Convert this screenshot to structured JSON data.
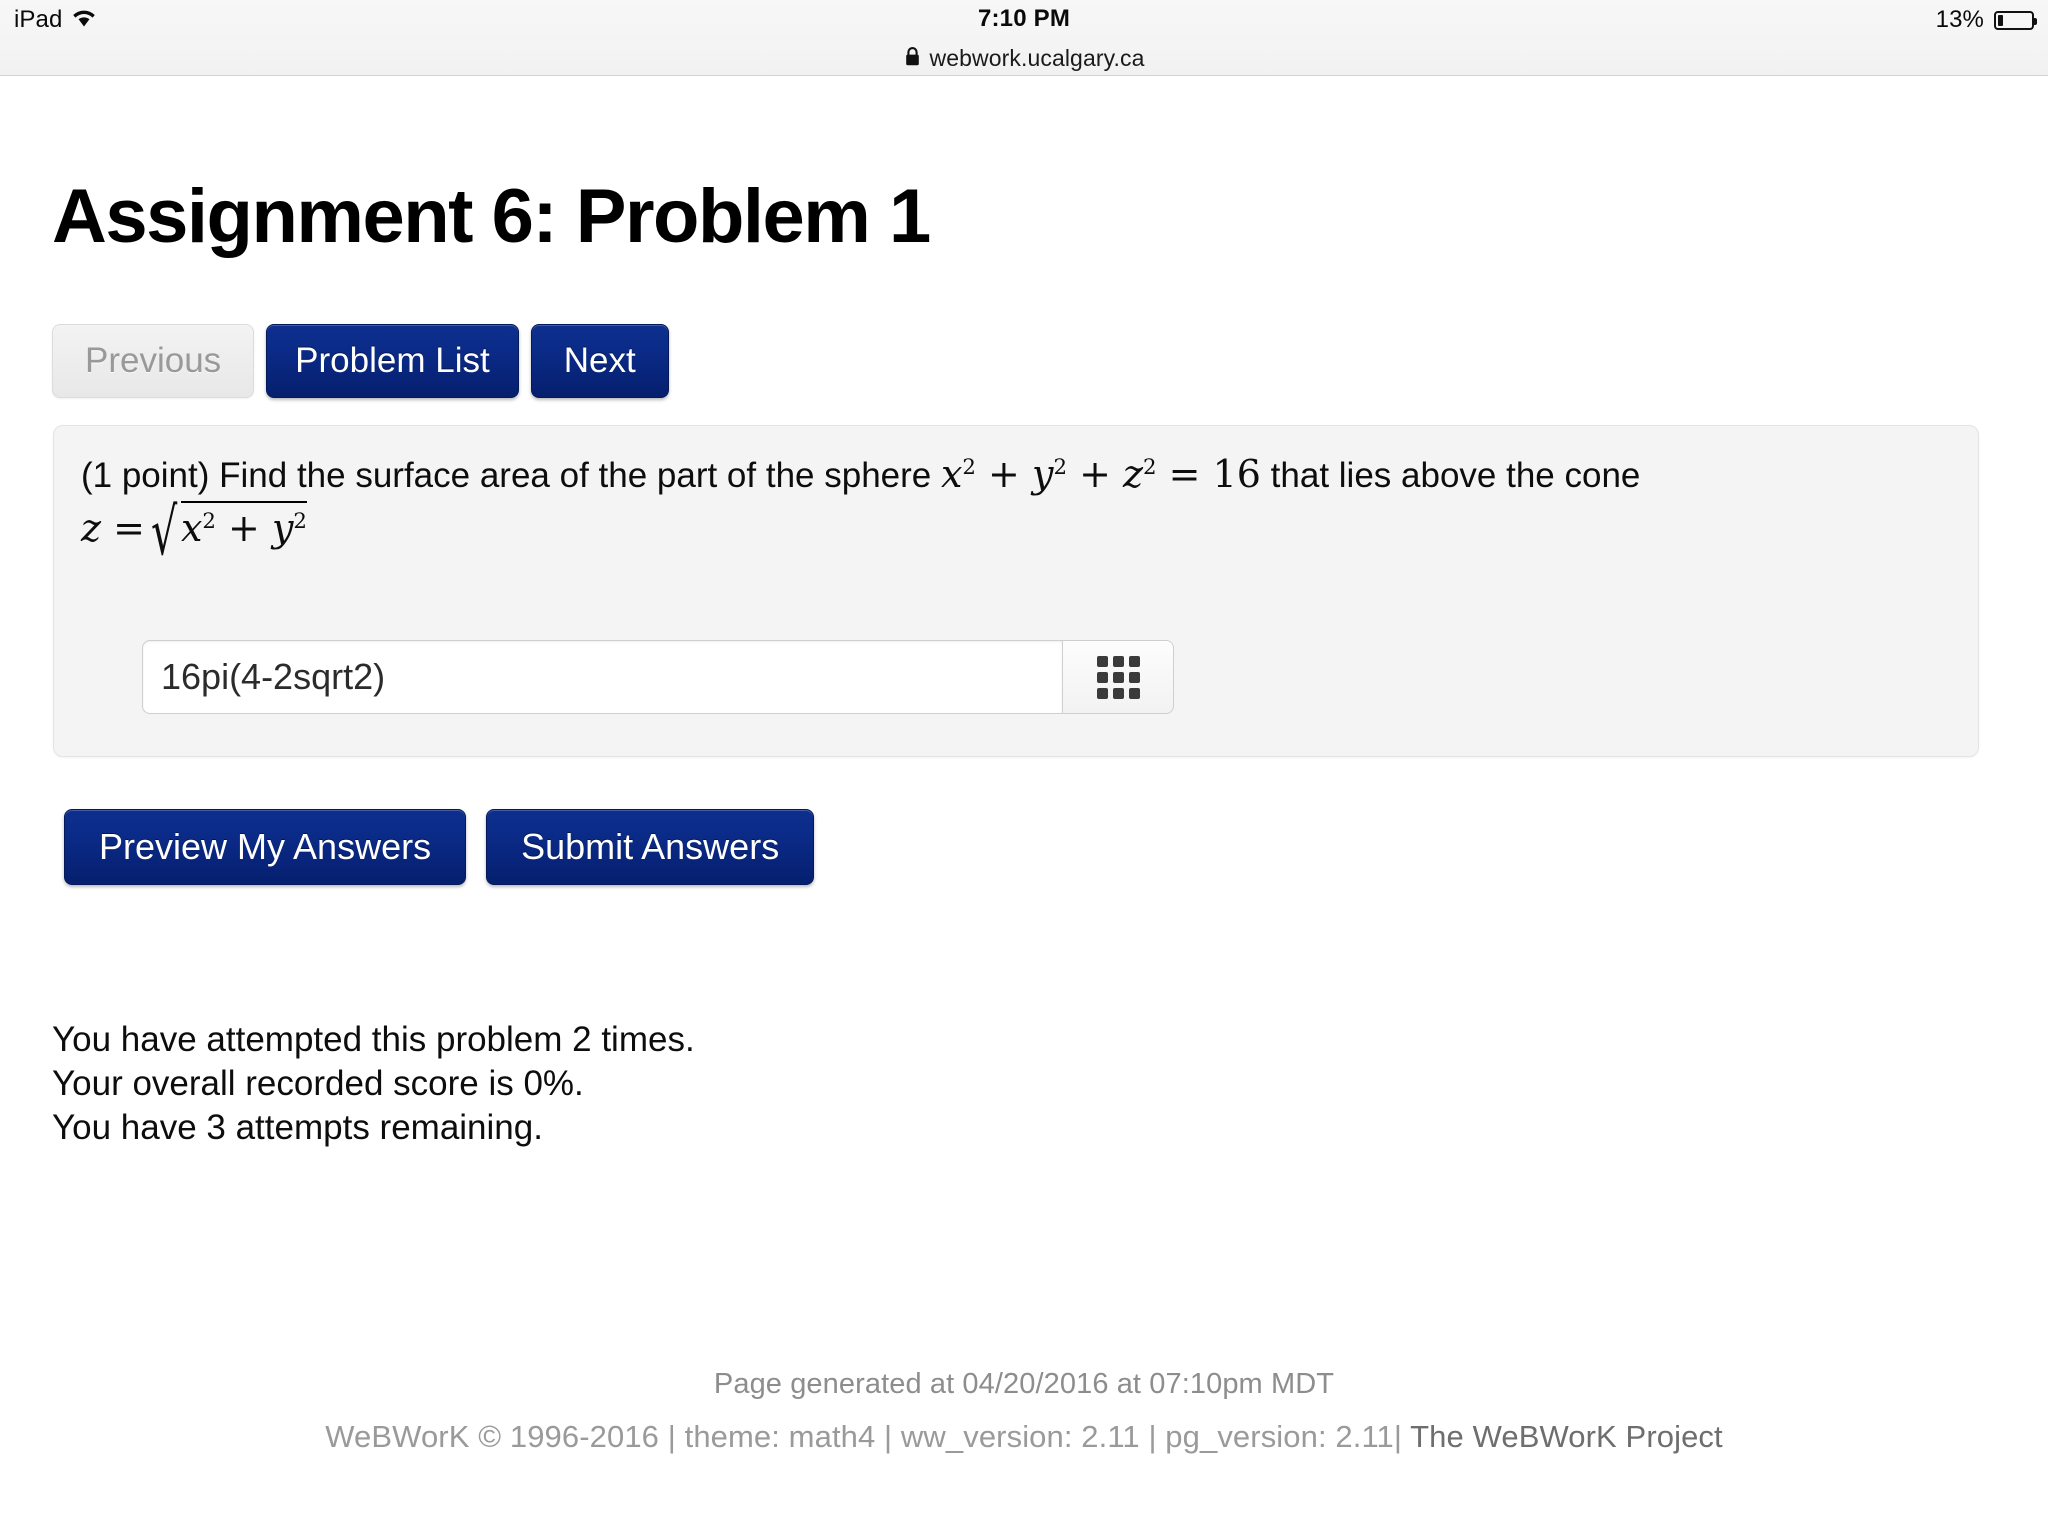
{
  "ios": {
    "device_label": "iPad",
    "wifi_icon": "wifi-icon",
    "time": "7:10 PM",
    "battery_percent": "13%",
    "battery_icon": "battery-icon",
    "lock_icon": "lock-icon",
    "url": "webwork.ucalgary.ca"
  },
  "page": {
    "title": "Assignment 6: Problem 1"
  },
  "nav": {
    "previous_label": "Previous",
    "problem_list_label": "Problem List",
    "next_label": "Next"
  },
  "problem": {
    "points": "(1 point)",
    "text_before": "Find the surface area of the part of the sphere",
    "equation_sphere": "x² + y² + z² = 16",
    "text_middle": "that lies above the cone",
    "equation_cone": "z = √(x² + y²)",
    "answer_value": "16pi(4-2sqrt2)",
    "answer_placeholder": "",
    "keypad_icon": "keypad-icon"
  },
  "actions": {
    "preview_label": "Preview My Answers",
    "submit_label": "Submit Answers"
  },
  "status": {
    "attempts_line": "You have attempted this problem 2 times.",
    "score_line": "Your overall recorded score is 0%.",
    "remaining_line": "You have 3 attempts remaining."
  },
  "footer": {
    "generated": "Page generated at 04/20/2016 at 07:10pm MDT",
    "credits": "WeBWorK © 1996-2016 | theme: math4 | ww_version: 2.11 | pg_version: 2.11| ",
    "project_link": "The WeBWorK Project"
  },
  "colors": {
    "button_blue": "#0a2a86",
    "panel_bg": "#f4f4f4",
    "page_bg": "#ffffff",
    "footer_text": "#9a9a9a"
  }
}
